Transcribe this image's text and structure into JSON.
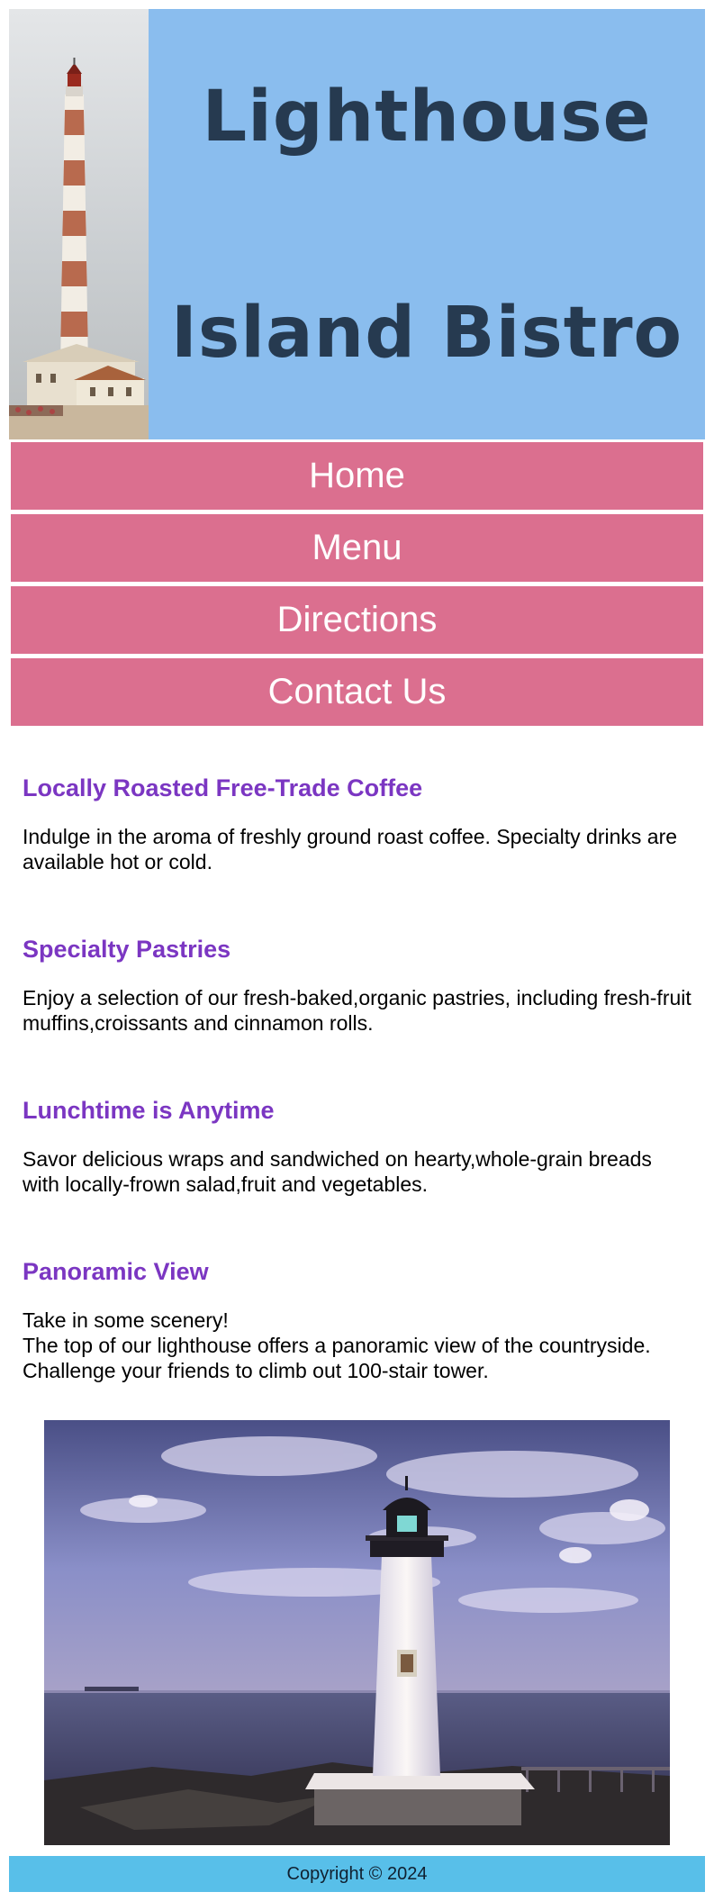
{
  "header": {
    "title_line1": "Lighthouse",
    "title_line2": "Island Bistro",
    "bg_color": "#8abdee"
  },
  "nav": {
    "items": [
      {
        "label": "Home"
      },
      {
        "label": "Menu"
      },
      {
        "label": "Directions"
      },
      {
        "label": "Contact Us"
      }
    ],
    "bg_color": "#db6f8f"
  },
  "sections": [
    {
      "heading": "Locally Roasted Free-Trade Coffee",
      "text": "Indulge in the aroma of freshly ground roast coffee. Specialty drinks are available hot or cold."
    },
    {
      "heading": "Specialty Pastries",
      "text": "Enjoy a selection of our fresh-baked,organic pastries, including fresh-fruit muffins,croissants and cinnamon rolls."
    },
    {
      "heading": "Lunchtime is Anytime",
      "text": "Savor delicious wraps and sandwiched on hearty,whole-grain breads with locally-frown salad,fruit and vegetables."
    },
    {
      "heading": "Panoramic View",
      "text_lines": [
        "Take in some scenery!",
        "The top of our lighthouse offers a panoramic view of the countryside.",
        "Challenge your friends to climb out 100-stair tower."
      ]
    }
  ],
  "footer": {
    "text": "Copyright © 2024",
    "bg_color": "#58bfe9"
  }
}
